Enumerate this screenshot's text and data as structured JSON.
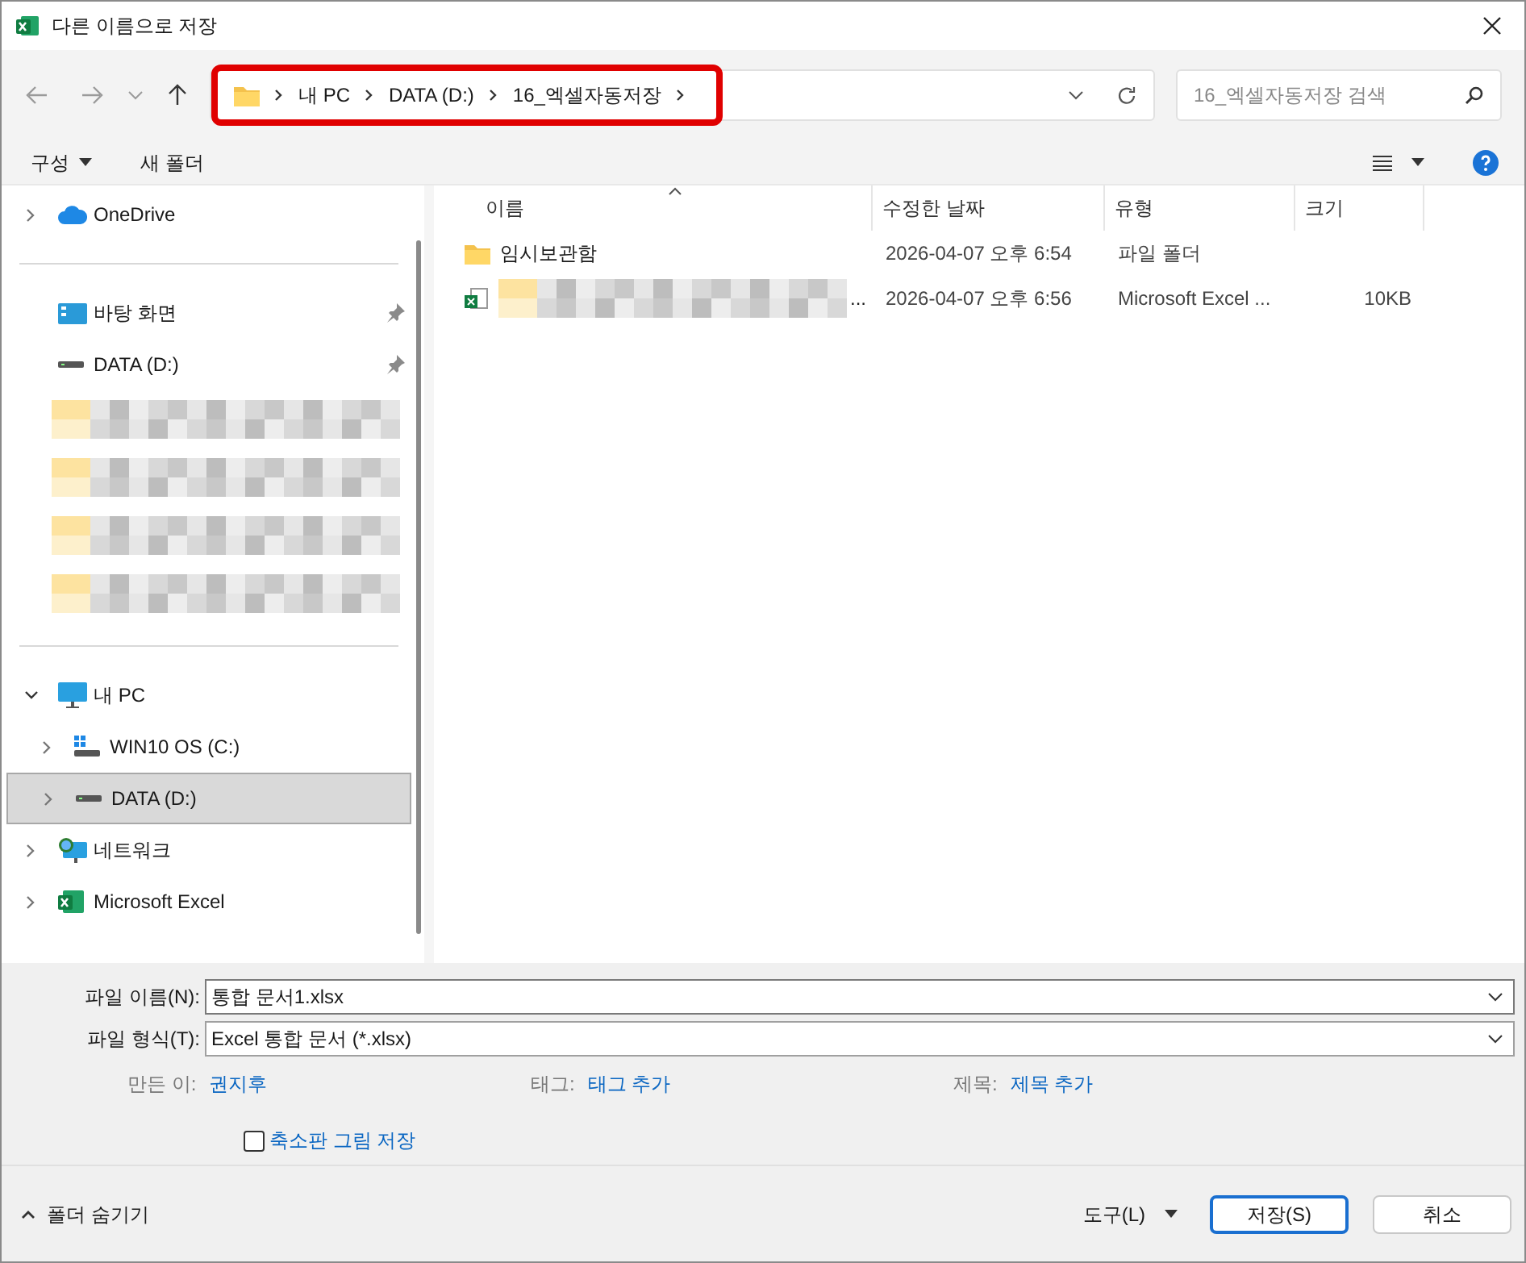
{
  "window": {
    "title": "다른 이름으로 저장"
  },
  "address": {
    "crumbs": [
      "내 PC",
      "DATA (D:)",
      "16_엑셀자동저장"
    ],
    "highlighted": true
  },
  "search": {
    "placeholder": "16_엑셀자동저장 검색"
  },
  "toolbar": {
    "organize": "구성",
    "new_folder": "새 폴더"
  },
  "sidebar": [
    {
      "kind": "onedrive",
      "label": "OneDrive",
      "expanded": false
    },
    {
      "kind": "divider"
    },
    {
      "kind": "desktop",
      "label": "바탕 화면",
      "pinned": true
    },
    {
      "kind": "drive",
      "label": "DATA (D:)",
      "pinned": true
    },
    {
      "kind": "redacted"
    },
    {
      "kind": "redacted"
    },
    {
      "kind": "redacted"
    },
    {
      "kind": "redacted"
    },
    {
      "kind": "divider"
    },
    {
      "kind": "pc",
      "label": "내 PC",
      "expanded": true,
      "children": [
        {
          "kind": "windrive",
          "label": "WIN10 OS (C:)",
          "expanded": false,
          "selected": false
        },
        {
          "kind": "drive",
          "label": "DATA (D:)",
          "expanded": false,
          "selected": true
        }
      ]
    },
    {
      "kind": "network",
      "label": "네트워크",
      "expanded": false
    },
    {
      "kind": "excel",
      "label": "Microsoft Excel",
      "expanded": false
    }
  ],
  "table": {
    "columns": [
      "이름",
      "수정한 날짜",
      "유형",
      "크기"
    ],
    "rows": [
      {
        "kind": "folder",
        "name": "임시보관함",
        "redacted": false,
        "date": "2026-04-07 오후 6:54",
        "type": "파일 폴더"
      },
      {
        "kind": "excel",
        "name": "...",
        "redacted": true,
        "date": "2026-04-07 오후 6:56",
        "type": "Microsoft Excel ...",
        "size": "10KB"
      }
    ]
  },
  "form": {
    "filename_label": "파일 이름(N):",
    "filename": "통합 문서1.xlsx",
    "filetype_label": "파일 형식(T):",
    "filetype": "Excel 통합 문서 (*.xlsx)",
    "meta": [
      {
        "label": "만든 이:",
        "value": "권지후"
      },
      {
        "label": "태그:",
        "value": "태그 추가"
      },
      {
        "label": "제목:",
        "value": "제목 추가"
      }
    ],
    "thumbnail": {
      "label": "축소판 그림 저장",
      "checked": false
    }
  },
  "footer": {
    "hide_folders": "폴더 숨기기",
    "tools": "도구(L)",
    "save": "저장(S)",
    "cancel": "취소"
  }
}
